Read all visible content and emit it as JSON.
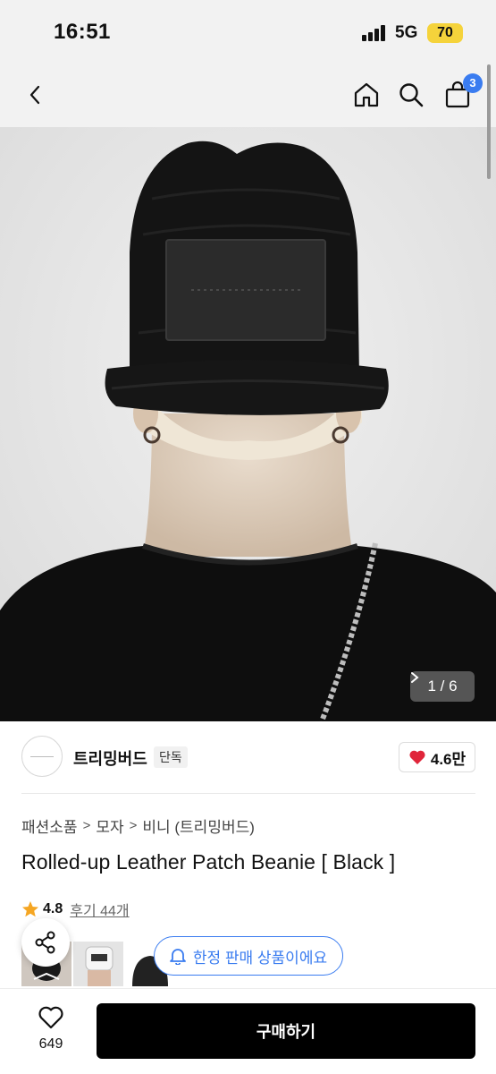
{
  "status_bar": {
    "time": "16:51",
    "network": "5G",
    "battery": "70"
  },
  "nav": {
    "cart_count": "3"
  },
  "hero": {
    "image_counter": "1 / 6"
  },
  "store": {
    "name": "트리밍버드",
    "badge": "단독",
    "likes": "4.6만"
  },
  "breadcrumb": [
    "패션소품",
    "모자",
    "비니 (트리밍버드)"
  ],
  "product": {
    "title": "Rolled-up Leather Patch Beanie [ Black ]",
    "rating": "4.8",
    "reviews": "후기 44개"
  },
  "limited_notice": "한정 판매 상품이에요",
  "bottom_bar": {
    "wish_count": "649",
    "buy_label": "구매하기"
  },
  "icons": [
    "back-icon",
    "home-icon",
    "search-icon",
    "cart-icon",
    "chevron-right-icon",
    "heart-icon",
    "star-icon",
    "share-icon",
    "bell-icon",
    "heart-outline-icon"
  ],
  "colors": {
    "accent": "#3a7cf0",
    "battery": "#f5d33b",
    "heart": "#e0253a",
    "star": "#f5a623",
    "buy_button": "#000000"
  }
}
